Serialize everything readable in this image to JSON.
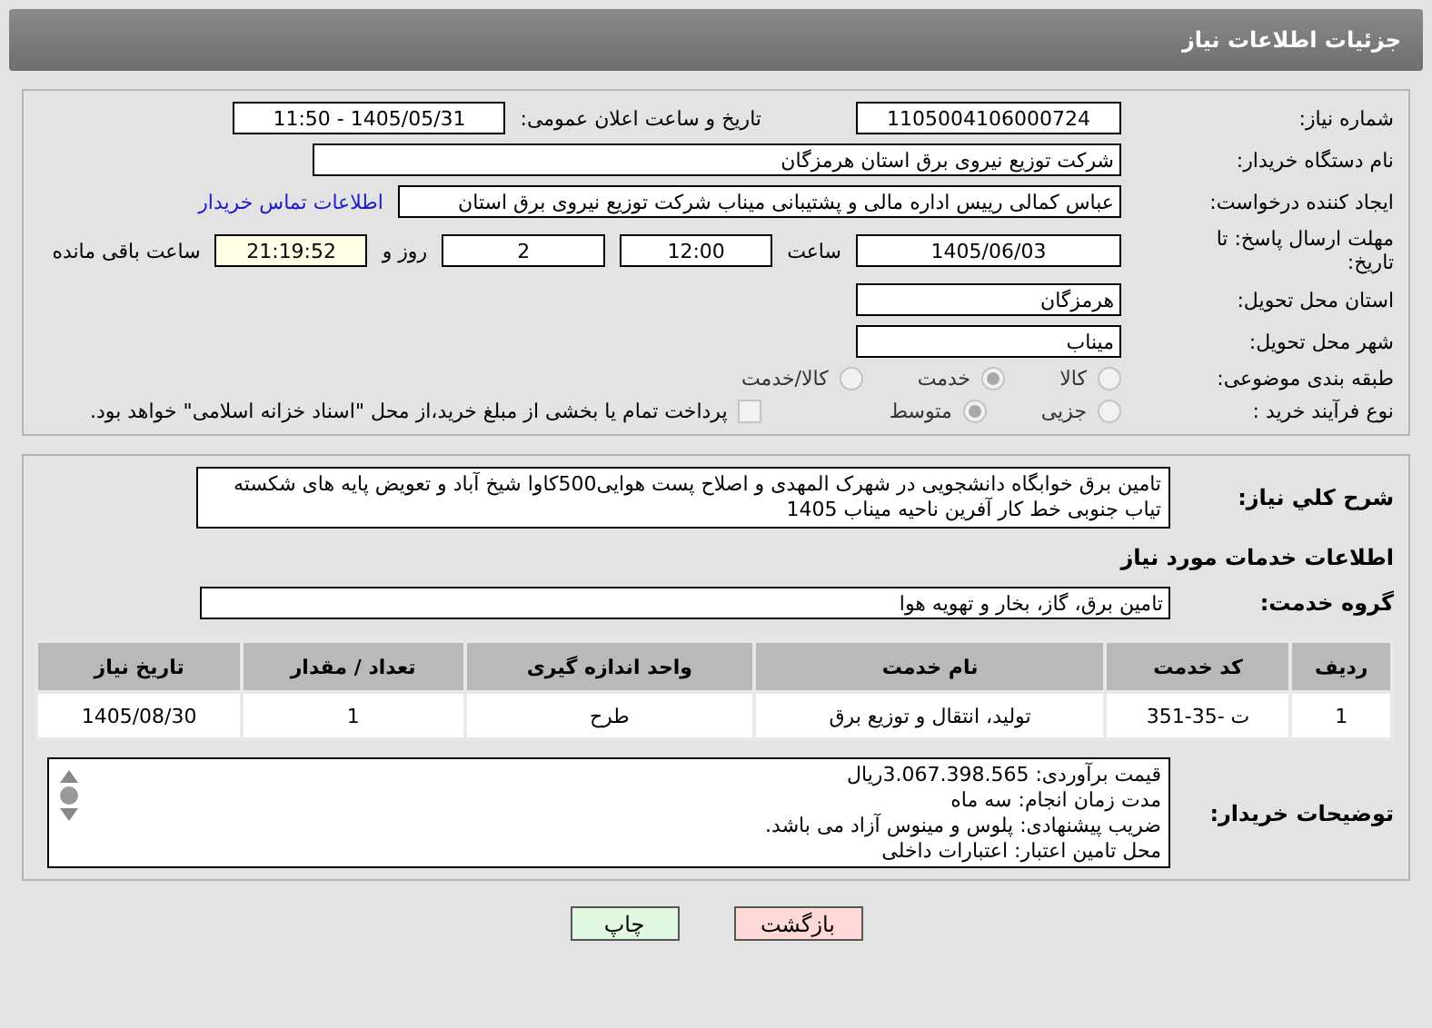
{
  "header": {
    "title": "جزئیات اطلاعات نیاز"
  },
  "need_number": {
    "label": "شماره نیاز:",
    "value": "1105004106000724"
  },
  "announce": {
    "label": "تاریخ و ساعت اعلان عمومی:",
    "value": "1405/05/31 - 11:50"
  },
  "buyer": {
    "label": "نام دستگاه خریدار:",
    "value": "شرکت توزیع نیروی برق استان هرمزگان"
  },
  "creator": {
    "label": "ایجاد کننده درخواست:",
    "value": "عباس کمالی رییس اداره مالی و پشتیبانی میناب شرکت توزیع نیروی برق استان",
    "link": "اطلاعات تماس خریدار"
  },
  "deadline": {
    "label": "مهلت ارسال پاسخ: تا تاریخ:",
    "date": "1405/06/03",
    "time_label": "ساعت",
    "time": "12:00",
    "days": "2",
    "days_label": "روز و",
    "remaining": "21:19:52",
    "remaining_label": "ساعت باقی مانده"
  },
  "province": {
    "label": "استان محل تحویل:",
    "value": "هرمزگان"
  },
  "city": {
    "label": "شهر محل تحویل:",
    "value": "میناب"
  },
  "category": {
    "label": "طبقه بندی موضوعی:",
    "options": [
      {
        "label": "کالا",
        "selected": false
      },
      {
        "label": "خدمت",
        "selected": true
      },
      {
        "label": "کالا/خدمت",
        "selected": false
      }
    ]
  },
  "process": {
    "label": "نوع فرآیند خرید :",
    "options": [
      {
        "label": "جزیی",
        "selected": false
      },
      {
        "label": "متوسط",
        "selected": true
      }
    ],
    "payment": {
      "checked": false,
      "text": "پرداخت تمام یا بخشی از مبلغ خرید،از محل \"اسناد خزانه اسلامی\" خواهد بود."
    }
  },
  "description": {
    "label": "شرح کلي نياز:",
    "value": "تامین برق خوابگاه دانشجویی در شهرک المهدی و اصلاح پست هوایی500کاوا شیخ آباد و تعویض پایه های شکسته تیاب جنوبی خط کار آفرین ناحیه میناب  1405"
  },
  "services_heading": "اطلاعات خدمات مورد نياز",
  "service_group": {
    "label": "گروه خدمت:",
    "value": "تامین برق، گاز، بخار و تهویه هوا"
  },
  "table": {
    "columns": [
      "ردیف",
      "کد خدمت",
      "نام خدمت",
      "واحد اندازه گیری",
      "تعداد / مقدار",
      "تاریخ نیاز"
    ],
    "rows": [
      [
        "1",
        "ت -35-351",
        "تولید، انتقال و توزیع برق",
        "طرح",
        "1",
        "1405/08/30"
      ]
    ]
  },
  "buyer_notes": {
    "label": "توضیحات خریدار:",
    "lines": [
      "قیمت برآوردی: 3.067.398.565ریال",
      "مدت زمان انجام: سه ماه",
      "ضریب پیشنهادی: پلوس  و مینوس آزاد می باشد.",
      "محل تامین اعتبار:  اعتبارات  داخلی"
    ]
  },
  "buttons": [
    {
      "label": "بازگشت",
      "kind": "back"
    },
    {
      "label": "چاپ",
      "kind": "print"
    }
  ]
}
